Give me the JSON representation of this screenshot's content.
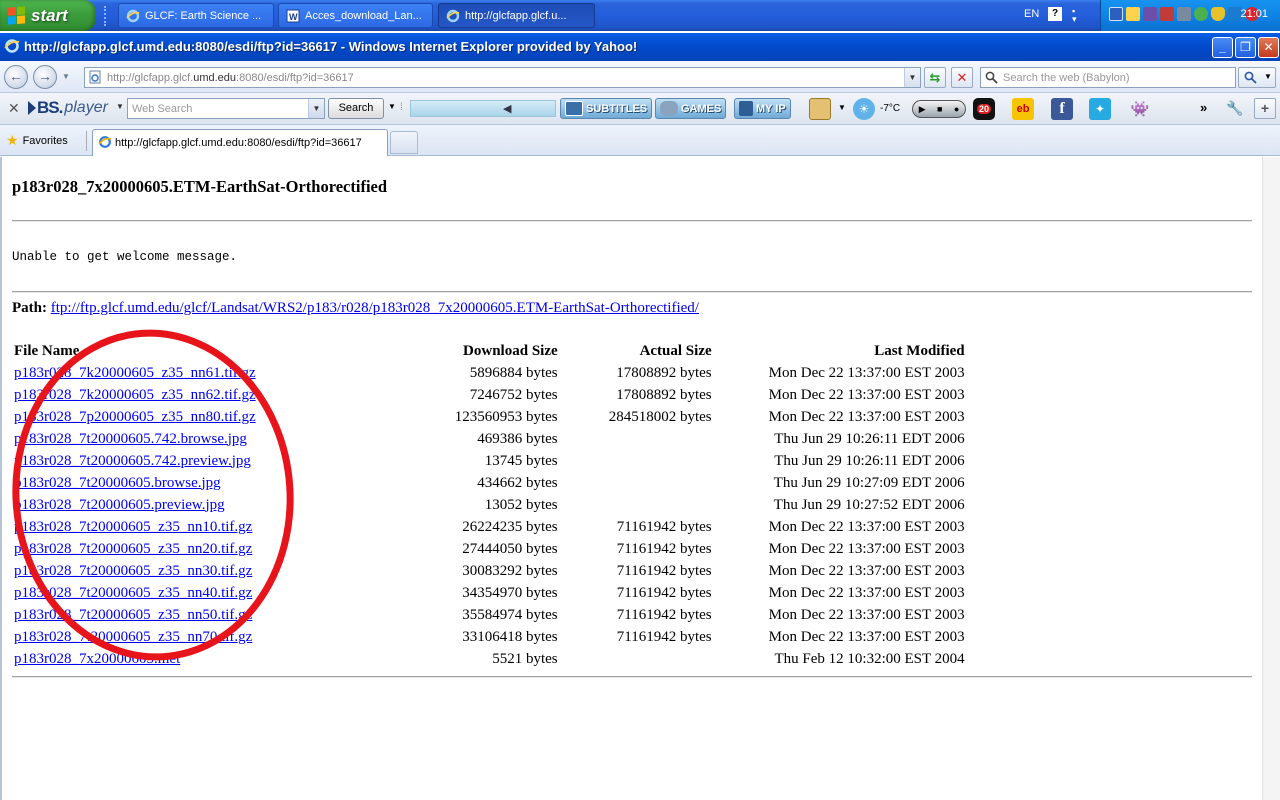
{
  "taskbar": {
    "start_label": "start",
    "tasks": [
      {
        "label": "GLCF: Earth Science ..."
      },
      {
        "label": "Acces_download_Lan..."
      },
      {
        "label": "http://glcfapp.glcf.u..."
      }
    ],
    "language": "EN",
    "clock": "21:01"
  },
  "window": {
    "title": "http://glcfapp.glcf.umd.edu:8080/esdi/ftp?id=36617 - Windows Internet Explorer provided by Yahoo!"
  },
  "address_bar": {
    "url_prefix": "http://glcfapp.glcf.",
    "url_domain": "umd.edu",
    "url_suffix": ":8080/esdi/ftp?id=36617",
    "search_placeholder": "Search the web (Babylon)"
  },
  "toolbar": {
    "brand_bs": "BS.",
    "brand_player": "player",
    "web_search_placeholder": "Web Search",
    "search_button": "Search",
    "subtitles": "SUBTITLES",
    "games": "GAMES",
    "myip": "MY IP",
    "temperature": "-7°C",
    "badge_count": "20"
  },
  "favorites_bar": {
    "favorites_label": "Favorites",
    "tab_title": "http://glcfapp.glcf.umd.edu:8080/esdi/ftp?id=36617"
  },
  "page": {
    "heading": "p183r028_7x20000605.ETM-EarthSat-Orthorectified",
    "welcome_message": "Unable to get welcome message.",
    "path_label": "Path:",
    "path_link": "ftp://ftp.glcf.umd.edu/glcf/Landsat/WRS2/p183/r028/p183r028_7x20000605.ETM-EarthSat-Orthorectified/",
    "columns": [
      "File Name",
      "Download Size",
      "Actual Size",
      "Last Modified"
    ],
    "files": [
      {
        "name": "p183r028_7k20000605_z35_nn61.tif.gz",
        "download": "5896884 bytes",
        "actual": "17808892 bytes",
        "modified": "Mon Dec 22 13:37:00 EST 2003"
      },
      {
        "name": "p183r028_7k20000605_z35_nn62.tif.gz",
        "download": "7246752 bytes",
        "actual": "17808892 bytes",
        "modified": "Mon Dec 22 13:37:00 EST 2003"
      },
      {
        "name": "p183r028_7p20000605_z35_nn80.tif.gz",
        "download": "123560953 bytes",
        "actual": "284518002 bytes",
        "modified": "Mon Dec 22 13:37:00 EST 2003"
      },
      {
        "name": "p183r028_7t20000605.742.browse.jpg",
        "download": "469386 bytes",
        "actual": "",
        "modified": "Thu Jun 29 10:26:11 EDT 2006"
      },
      {
        "name": "p183r028_7t20000605.742.preview.jpg",
        "download": "13745 bytes",
        "actual": "",
        "modified": "Thu Jun 29 10:26:11 EDT 2006"
      },
      {
        "name": "p183r028_7t20000605.browse.jpg",
        "download": "434662 bytes",
        "actual": "",
        "modified": "Thu Jun 29 10:27:09 EDT 2006"
      },
      {
        "name": "p183r028_7t20000605.preview.jpg",
        "download": "13052 bytes",
        "actual": "",
        "modified": "Thu Jun 29 10:27:52 EDT 2006"
      },
      {
        "name": "p183r028_7t20000605_z35_nn10.tif.gz",
        "download": "26224235 bytes",
        "actual": "71161942 bytes",
        "modified": "Mon Dec 22 13:37:00 EST 2003"
      },
      {
        "name": "p183r028_7t20000605_z35_nn20.tif.gz",
        "download": "27444050 bytes",
        "actual": "71161942 bytes",
        "modified": "Mon Dec 22 13:37:00 EST 2003"
      },
      {
        "name": "p183r028_7t20000605_z35_nn30.tif.gz",
        "download": "30083292 bytes",
        "actual": "71161942 bytes",
        "modified": "Mon Dec 22 13:37:00 EST 2003"
      },
      {
        "name": "p183r028_7t20000605_z35_nn40.tif.gz",
        "download": "34354970 bytes",
        "actual": "71161942 bytes",
        "modified": "Mon Dec 22 13:37:00 EST 2003"
      },
      {
        "name": "p183r028_7t20000605_z35_nn50.tif.gz",
        "download": "35584974 bytes",
        "actual": "71161942 bytes",
        "modified": "Mon Dec 22 13:37:00 EST 2003"
      },
      {
        "name": "p183r028_7t20000605_z35_nn70.tif.gz",
        "download": "33106418 bytes",
        "actual": "71161942 bytes",
        "modified": "Mon Dec 22 13:37:00 EST 2003"
      },
      {
        "name": "p183r028_7x20000605.met",
        "download": "5521 bytes",
        "actual": "",
        "modified": "Thu Feb 12 10:32:00 EST 2004"
      }
    ]
  },
  "colors": {
    "annotation_circle": "#e8141c",
    "link": "#0000ee"
  }
}
